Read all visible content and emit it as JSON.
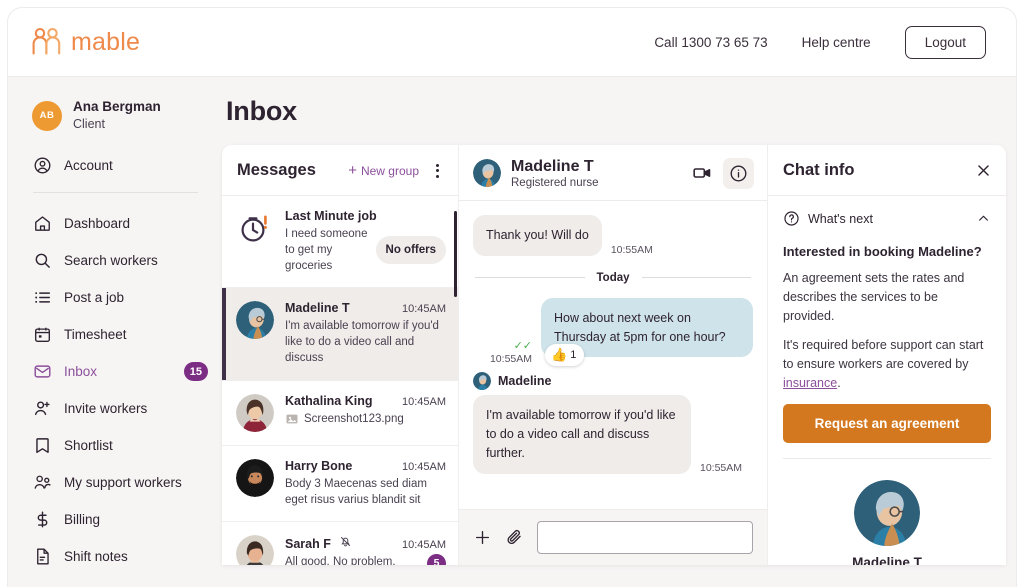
{
  "header": {
    "logo_text": "mable",
    "logo_color": "#ef8a4a",
    "call_link": "Call 1300 73 65 73",
    "help_link": "Help centre",
    "logout_label": "Logout"
  },
  "sidebar": {
    "user": {
      "initials": "AB",
      "name": "Ana Bergman",
      "role": "Client",
      "avatar_color": "#ee9a33"
    },
    "account_label": "Account",
    "items": [
      {
        "label": "Dashboard",
        "icon": "home-icon",
        "active": false
      },
      {
        "label": "Search workers",
        "icon": "search-icon",
        "active": false
      },
      {
        "label": "Post a job",
        "icon": "list-icon",
        "active": false
      },
      {
        "label": "Timesheet",
        "icon": "calendar-icon",
        "active": false
      },
      {
        "label": "Inbox",
        "icon": "envelope-icon",
        "active": true,
        "badge": "15"
      },
      {
        "label": "Invite workers",
        "icon": "user-plus-icon",
        "active": false
      },
      {
        "label": "Shortlist",
        "icon": "bookmark-icon",
        "active": false
      },
      {
        "label": "My support workers",
        "icon": "users-icon",
        "active": false
      },
      {
        "label": "Billing",
        "icon": "dollar-icon",
        "active": false
      },
      {
        "label": "Shift notes",
        "icon": "document-icon",
        "active": false
      }
    ]
  },
  "main": {
    "page_title": "Inbox"
  },
  "messages_panel": {
    "title": "Messages",
    "new_group_label": "New group",
    "conversations": [
      {
        "name": "Last Minute job",
        "time": "",
        "preview": "I need someone to get my groceries",
        "pill": "No offers",
        "avatar_type": "stopwatch-alert-icon",
        "selected": false
      },
      {
        "name": "Madeline T",
        "time": "10:45AM",
        "preview": "I'm available tomorrow if you'd like to do a video call and discuss",
        "avatar_type": "photo-madeline",
        "selected": true
      },
      {
        "name": "Kathalina King",
        "time": "10:45AM",
        "preview": "Screenshot123.png",
        "attachment": true,
        "avatar_type": "photo-kathalina",
        "selected": false
      },
      {
        "name": "Harry Bone",
        "time": "10:45AM",
        "preview": "Body 3 Maecenas sed diam eget risus varius blandit sit",
        "avatar_type": "photo-harry",
        "selected": false
      },
      {
        "name": "Sarah F",
        "time": "10:45AM",
        "preview": "All good. No problem.",
        "muted": true,
        "unread": "5",
        "avatar_type": "photo-sarah",
        "selected": false
      }
    ]
  },
  "chat": {
    "contact_name": "Madeline T",
    "contact_role": "Registered nurse",
    "day_separator": "Today",
    "messages": [
      {
        "direction": "in",
        "text": "Thank you! Will do",
        "time": "10:55AM",
        "sender": ""
      },
      {
        "direction": "out",
        "text": "How about next week on Thursday at 5pm for one hour?",
        "time": "10:55AM",
        "read_receipt": "✓✓",
        "reaction_emoji": "👍",
        "reaction_count": "1"
      },
      {
        "direction": "in",
        "sender": "Madeline",
        "text": "I'm available tomorrow if you'd like to do a video call and discuss further.",
        "time": "10:55AM"
      }
    ],
    "composer_placeholder": ""
  },
  "info_panel": {
    "title": "Chat info",
    "whats_next_label": "What's next",
    "heading": "Interested in booking Madeline?",
    "paragraph_1": "An agreement sets the rates and describes the services to be provided.",
    "paragraph_2_pre": "It's required before support can start to ensure workers are covered by ",
    "paragraph_2_link": "insurance",
    "paragraph_2_post": ".",
    "cta_label": "Request an agreement",
    "cta_color": "#d4781f",
    "profile_name": "Madeline T"
  }
}
